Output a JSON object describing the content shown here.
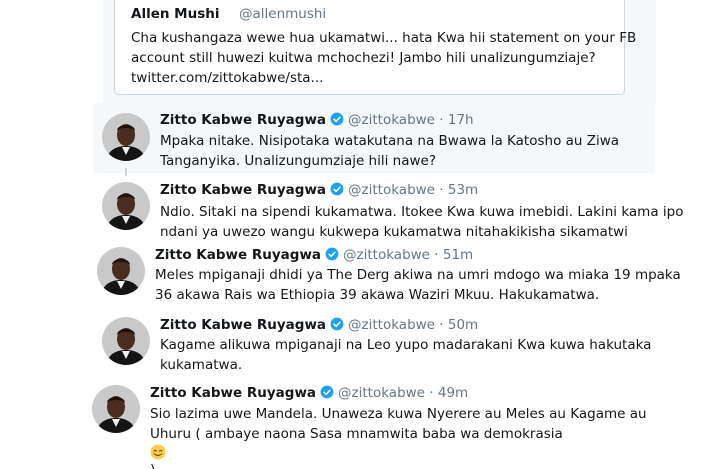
{
  "quoted_tweet": {
    "name": "Allen Mushi",
    "handle": "@allenmushi",
    "lines": [
      "Cha kushangaza wewe hua ukamatwi... hata Kwa hii statement on your FB",
      "account still huwezi kuitwa mchochezi! Jambo hili unalizungumziaje?",
      "twitter.com/zittokabwe/sta..."
    ]
  },
  "tweets": [
    {
      "name": "Zitto Kabwe Ruyagwa",
      "handle": "@zittokabwe",
      "time": "· 17h",
      "lines": [
        "Mpaka nitake. Nisipotaka watakutana na Bwawa la Katosho au Ziwa",
        "Tanganyika. Unalizungumziaje hili nawe?"
      ]
    },
    {
      "name": "Zitto Kabwe Ruyagwa",
      "handle": "@zittokabwe",
      "time": "· 53m",
      "lines": [
        "Ndio. Sitaki na sipendi kukamatwa. Itokee Kwa kuwa imebidi. Lakini kama ipo",
        "ndani ya uwezo wangu kukwepa kukamatwa nitahakikisha sikamatwi"
      ]
    },
    {
      "name": "Zitto Kabwe Ruyagwa",
      "handle": "@zittokabwe",
      "time": "· 51m",
      "lines": [
        "Meles mpiganaji dhidi ya The Derg akiwa na umri mdogo wa miaka 19 mpaka",
        "36 akawa Rais wa Ethiopia 39 akawa Waziri Mkuu. Hakukamatwa."
      ]
    },
    {
      "name": "Zitto Kabwe Ruyagwa",
      "handle": "@zittokabwe",
      "time": "· 50m",
      "lines": [
        "Kagame alikuwa mpiganaji na Leo yupo madarakani Kwa kuwa hakutaka",
        "kukamatwa."
      ]
    },
    {
      "name": "Zitto Kabwe Ruyagwa",
      "handle": "@zittokabwe",
      "time": "· 49m",
      "lines": [
        "Sio lazima uwe Mandela. Unaweza kuwa Nyerere au Meles au Kagame au",
        "Uhuru ( ambaye naona Sasa mnamwita baba wa demokrasia",
        ")."
      ]
    }
  ],
  "icons": {
    "verified": "verified-badge-icon",
    "emoji": "smiling-face-emoji",
    "avatar": "profile-photo"
  },
  "colors": {
    "verified": "#1da1f2",
    "secondary_text": "#657786",
    "highlight_bg": "#f5f8fa",
    "border": "#ccd6dd"
  }
}
